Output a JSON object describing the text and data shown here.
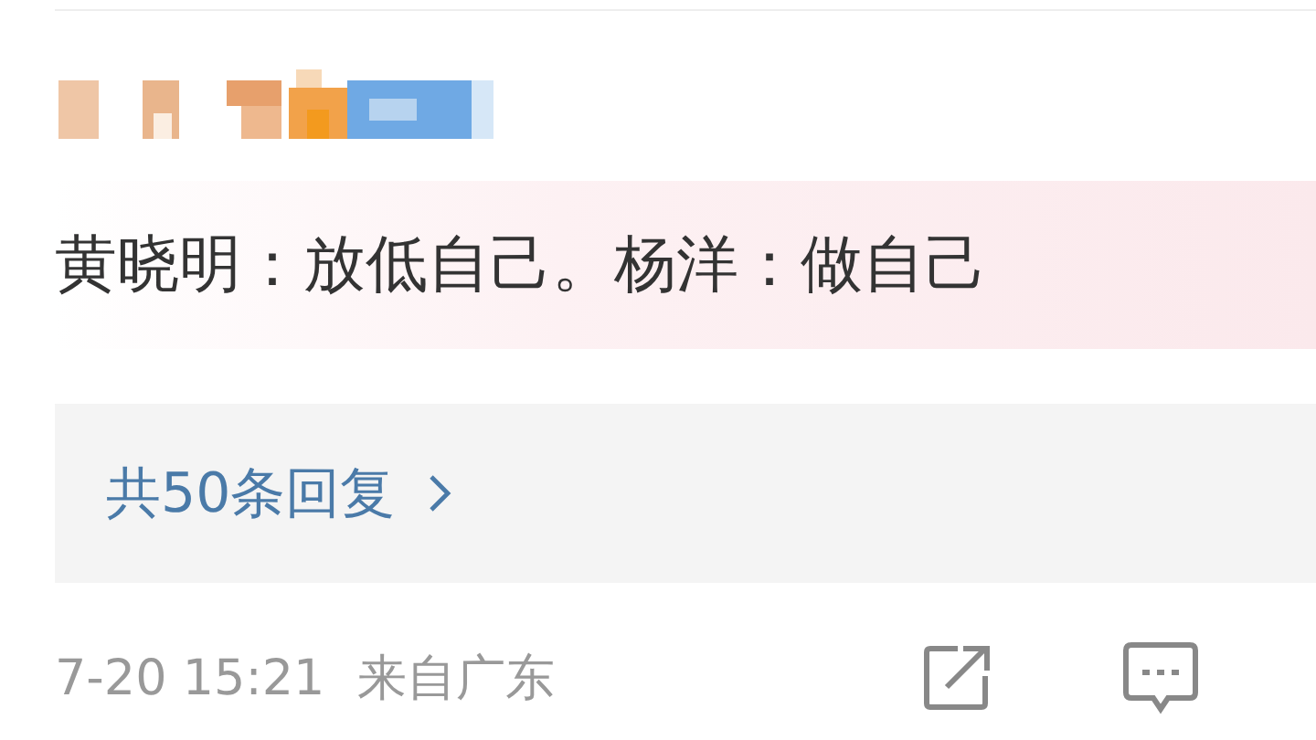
{
  "comment": {
    "text": "黄晓明：放低自己。杨洋：做自己"
  },
  "replies": {
    "label": "共50条回复"
  },
  "footer": {
    "time": "7-20 15:21",
    "location": "来自广东"
  }
}
